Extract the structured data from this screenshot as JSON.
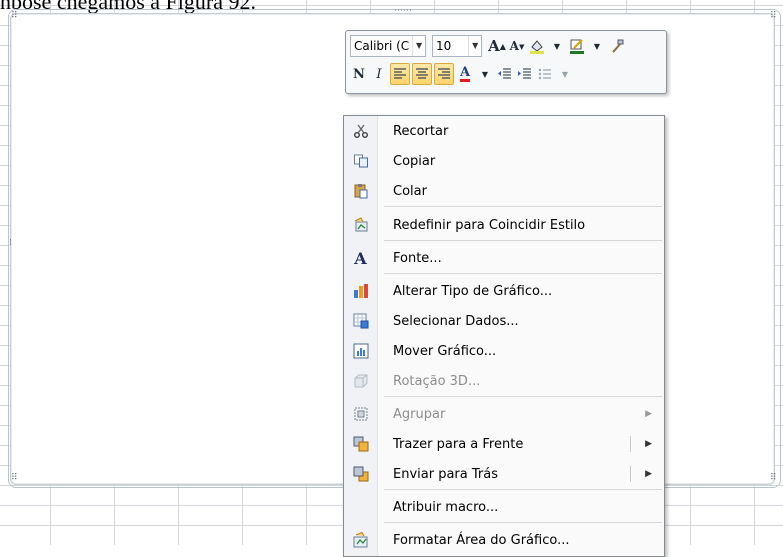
{
  "doc": {
    "top_text": "nbose chegamos à Figura 92."
  },
  "mini_toolbar": {
    "font_name": "Calibri (C",
    "font_size": "10",
    "bold": "N",
    "italic": "I"
  },
  "context_menu": {
    "items": [
      {
        "label": "Recortar",
        "icon": "scissors-icon",
        "disabled": false
      },
      {
        "label": "Copiar",
        "icon": "copy-icon",
        "disabled": false
      },
      {
        "label": "Colar",
        "icon": "paste-icon",
        "disabled": false
      },
      {
        "label": "Redefinir para Coincidir Estilo",
        "icon": "reset-style-icon",
        "disabled": false
      },
      {
        "label": "Fonte...",
        "icon": "font-icon",
        "disabled": false
      },
      {
        "label": "Alterar Tipo de Gráfico...",
        "icon": "chart-type-icon",
        "disabled": false
      },
      {
        "label": "Selecionar Dados...",
        "icon": "select-data-icon",
        "disabled": false
      },
      {
        "label": "Mover Gráfico...",
        "icon": "move-chart-icon",
        "disabled": false
      },
      {
        "label": "Rotação 3D...",
        "icon": "rotation-3d-icon",
        "disabled": true
      },
      {
        "label": "Agrupar",
        "icon": "group-icon",
        "disabled": true
      },
      {
        "label": "Trazer para a Frente",
        "icon": "bring-front-icon",
        "disabled": false
      },
      {
        "label": "Enviar para Trás",
        "icon": "send-back-icon",
        "disabled": false
      },
      {
        "label": "Atribuir macro...",
        "icon": "",
        "disabled": false
      },
      {
        "label": "Formatar Área do Gráfico...",
        "icon": "format-chart-area-icon",
        "disabled": false
      }
    ]
  }
}
